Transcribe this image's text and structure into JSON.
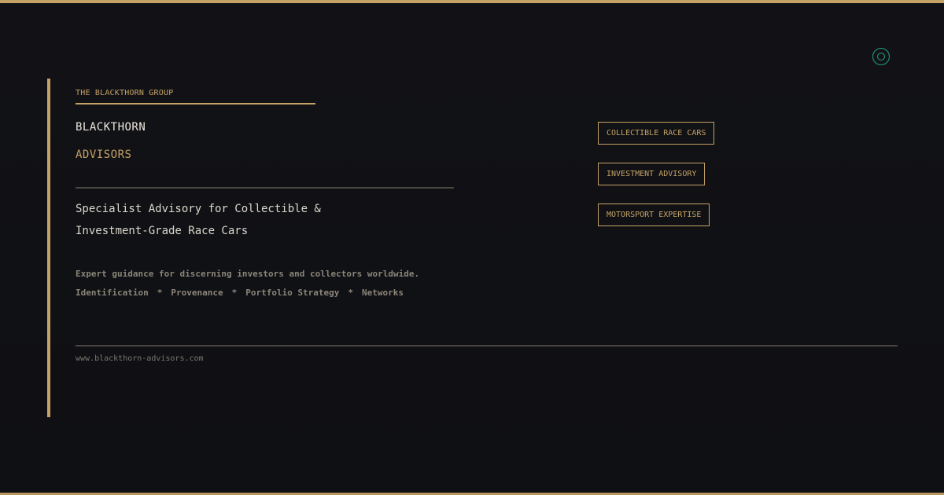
{
  "brand": {
    "group": "THE BLACKTHORN GROUP",
    "name_primary": "BLACKTHORN",
    "name_secondary": "ADVISORS"
  },
  "tagline": {
    "line1": "Specialist Advisory for Collectible &",
    "line2": "Investment-Grade Race Cars"
  },
  "description": {
    "line1": "Expert guidance for discerning investors and collectors worldwide.",
    "pillars": [
      "Identification",
      "Provenance",
      "Portfolio Strategy",
      "Networks"
    ],
    "separator": "*"
  },
  "services": [
    {
      "label": "COLLECTIBLE RACE CARS"
    },
    {
      "label": "INVESTMENT ADVISORY"
    },
    {
      "label": "MOTORSPORT EXPERTISE"
    }
  ],
  "footer": {
    "url": "www.blackthorn-advisors.com"
  },
  "icons": {
    "emblem": "emblem-ring-icon"
  },
  "colors": {
    "background": "#111115",
    "accent_gold": "#c4a265",
    "emblem_teal": "#1f8a70",
    "text_light": "#ece7dc",
    "text_muted": "#8b8679",
    "rule": "#4a4740"
  }
}
